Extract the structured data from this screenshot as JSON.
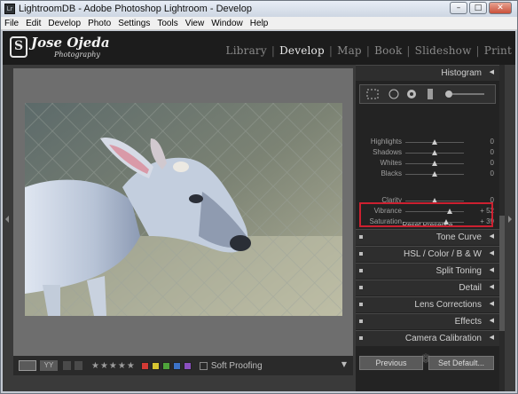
{
  "window": {
    "app_icon": "Lr",
    "title": "LightroomDB - Adobe Photoshop Lightroom - Develop",
    "minimize": "–",
    "maximize": "□",
    "close": "✕"
  },
  "menu": [
    "File",
    "Edit",
    "Develop",
    "Photo",
    "Settings",
    "Tools",
    "View",
    "Window",
    "Help"
  ],
  "identity_plate": {
    "name": "Jose Ojeda",
    "subtitle": "Photography"
  },
  "modules": [
    "Library",
    "Develop",
    "Map",
    "Book",
    "Slideshow",
    "Print"
  ],
  "active_module": "Develop",
  "filmstrip_toolbar": {
    "view_mode": "YY",
    "rating_stars": "★★★★★",
    "color_labels": [
      "#d33a35",
      "#d6c531",
      "#4ea33a",
      "#3c72c7",
      "#8a4fbf"
    ],
    "soft_proofing_label": "Soft Proofing",
    "menu_icon": "▼"
  },
  "right_panel": {
    "histogram_title": "Histogram",
    "tone_rows": [
      {
        "label": "Highlights",
        "value": "0",
        "pos": 0.5
      },
      {
        "label": "Shadows",
        "value": "0",
        "pos": 0.5
      },
      {
        "label": "Whites",
        "value": "0",
        "pos": 0.5
      },
      {
        "label": "Blacks",
        "value": "0",
        "pos": 0.5
      }
    ],
    "presence_reset": "Reset Presence",
    "presence_rows": [
      {
        "label": "Clarity",
        "value": "0",
        "pos": 0.5
      },
      {
        "label": "Vibrance",
        "value": "+ 52",
        "pos": 0.76
      },
      {
        "label": "Saturation",
        "value": "+ 39",
        "pos": 0.7
      }
    ],
    "panels": [
      "Tone Curve",
      "HSL / Color / B & W",
      "Split Toning",
      "Detail",
      "Lens Corrections",
      "Effects",
      "Camera Calibration"
    ],
    "collapse_icon": "◀",
    "buttons": {
      "previous": "Previous",
      "set_default": "Set Default..."
    }
  },
  "colors": {
    "panel_bg": "#232323",
    "highlight_box": "#cc2030"
  }
}
